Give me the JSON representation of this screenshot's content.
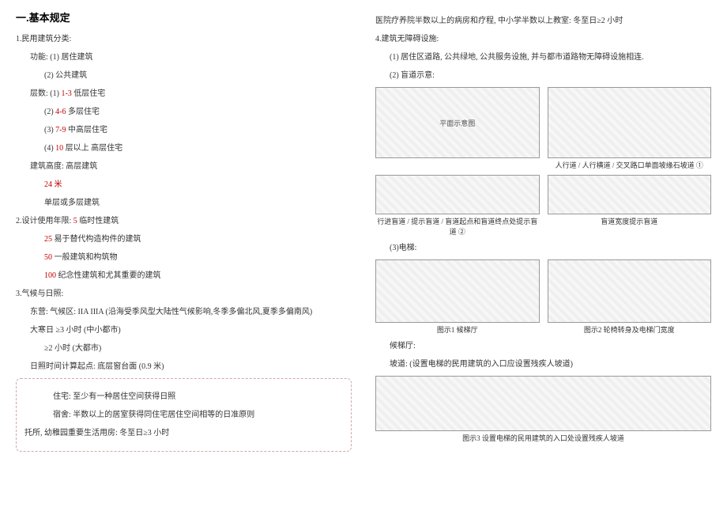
{
  "left": {
    "h1": "一.基本规定",
    "s1_title": "1.民用建筑分类:",
    "s1_func_label": "功能:",
    "s1_func_items": [
      "(1) 居住建筑",
      "(2) 公共建筑"
    ],
    "s1_floor_label": "层数:",
    "s1_floor_items": [
      {
        "prefix": "(1) ",
        "red": "1-3",
        "tail": " 低层住宅"
      },
      {
        "prefix": "(2) ",
        "red": "4-6",
        "tail": " 多层住宅"
      },
      {
        "prefix": "(3) ",
        "red": "7-9",
        "tail": " 中高层住宅"
      },
      {
        "prefix": "(4) ",
        "red": "10",
        "tail": " 层以上 高层住宅"
      }
    ],
    "s1_height_label": "建筑高度: 高层建筑",
    "s1_height_value": "24 米",
    "s1_height_tail": "单层或多层建筑",
    "s2_title": "2.设计使用年限: ",
    "s2_first_red": "5",
    "s2_first_tail": " 临时性建筑",
    "s2_items": [
      {
        "red": "25",
        "tail": " 易于替代构造构件的建筑"
      },
      {
        "red": "50",
        "tail": " 一般建筑和构筑物"
      },
      {
        "red": "100",
        "tail": " 纪念性建筑和尤其重要的建筑"
      }
    ],
    "s3_title": "3.气候与日照:",
    "s3_a": "东营: 气候区: IIA   IIIA  (沿海受季风型大陆性气候影响,冬季多偏北风,夏季多偏南风)",
    "s3_b": "大寒日   ≥3 小时 (中小都市)",
    "s3_c": "≥2 小时  (大都市)",
    "s3_d": "日照时间计算起点: 底层窗台面 (0.9 米)",
    "box1": "住宅: 至少有一种居住空间获得日照",
    "box2": "宿舍: 半数以上的居室获得同住宅居住空间相等的日准原则",
    "box3": "托所, 幼稚园重要生活用房: 冬至日≥3 小时"
  },
  "right": {
    "top1": "医院疗养院半数以上的病房和疗程, 中小学半数以上教室:      冬至日≥2 小时",
    "s4_title": "4.建筑无障碍设施:",
    "s4_a": "(1) 居住区道路, 公共绿地, 公共服务设施, 并与都市道路物无障碍设施相连.",
    "s4_b": "(2) 盲道示意:",
    "fig_blind_labels": {
      "a": "行进盲道 / 提示盲道 / 盲道起点和盲道终点处提示盲道 ②",
      "b": "人行道 / 人行横道 / 交叉路口单面坡缘石坡道 ①",
      "c": "盲道宽度提示盲道"
    },
    "s4_c": "(3)电梯:",
    "fig_elev_labels": {
      "a": "图示1 候梯厅",
      "b": "图示2 轮椅转身及电梯门宽度"
    },
    "s4_wait": "候梯厅:",
    "s4_ramp": "坡道: (设置电梯的民用建筑的入口应设置残疾人坡道)",
    "fig_ramp": "图示3  设置电梯的民用建筑的入口处设置残疾人坡道"
  }
}
